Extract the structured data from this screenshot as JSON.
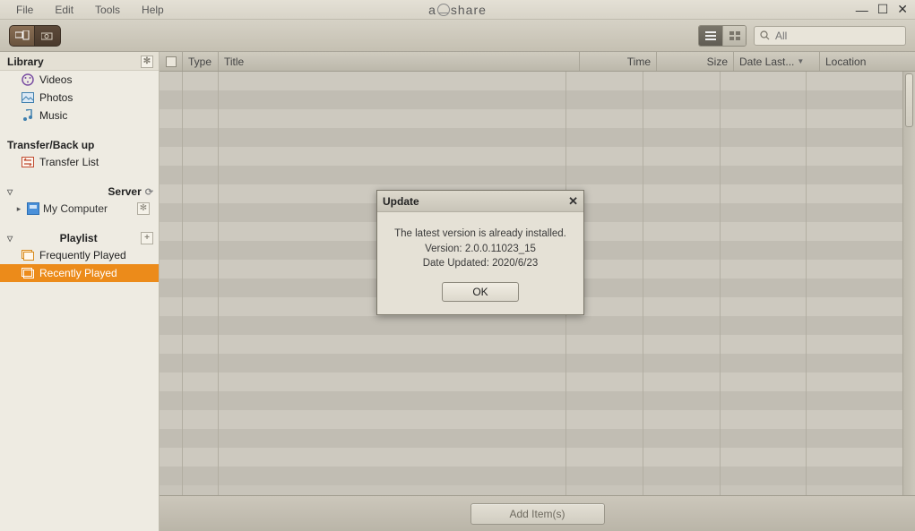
{
  "menu": {
    "items": [
      "File",
      "Edit",
      "Tools",
      "Help"
    ]
  },
  "app_brand": {
    "left": "a",
    "mid_glyph": "●",
    "right": "share"
  },
  "window_controls": {
    "minimize": "—",
    "maximize": "☐",
    "close": "✕"
  },
  "toolbar": {
    "view_list_tooltip": "List view",
    "view_grid_tooltip": "Grid view"
  },
  "search": {
    "placeholder": "All"
  },
  "sidebar": {
    "library": {
      "header": "Library",
      "items": [
        {
          "label": "Videos"
        },
        {
          "label": "Photos"
        },
        {
          "label": "Music"
        }
      ]
    },
    "transfer": {
      "header": "Transfer/Back up",
      "items": [
        {
          "label": "Transfer List"
        }
      ]
    },
    "server": {
      "header": "Server",
      "items": [
        {
          "label": "My Computer"
        }
      ]
    },
    "playlist": {
      "header": "Playlist",
      "items": [
        {
          "label": "Frequently Played"
        },
        {
          "label": "Recently Played"
        }
      ],
      "selected_index": 1
    }
  },
  "columns": {
    "type": "Type",
    "title": "Title",
    "time": "Time",
    "size": "Size",
    "date": "Date Last...",
    "location": "Location"
  },
  "bottom": {
    "add_items": "Add Item(s)"
  },
  "dialog": {
    "title": "Update",
    "line1": "The latest version is already installed.",
    "line2": "Version: 2.0.0.11023_15",
    "line3": "Date Updated: 2020/6/23",
    "ok": "OK"
  }
}
